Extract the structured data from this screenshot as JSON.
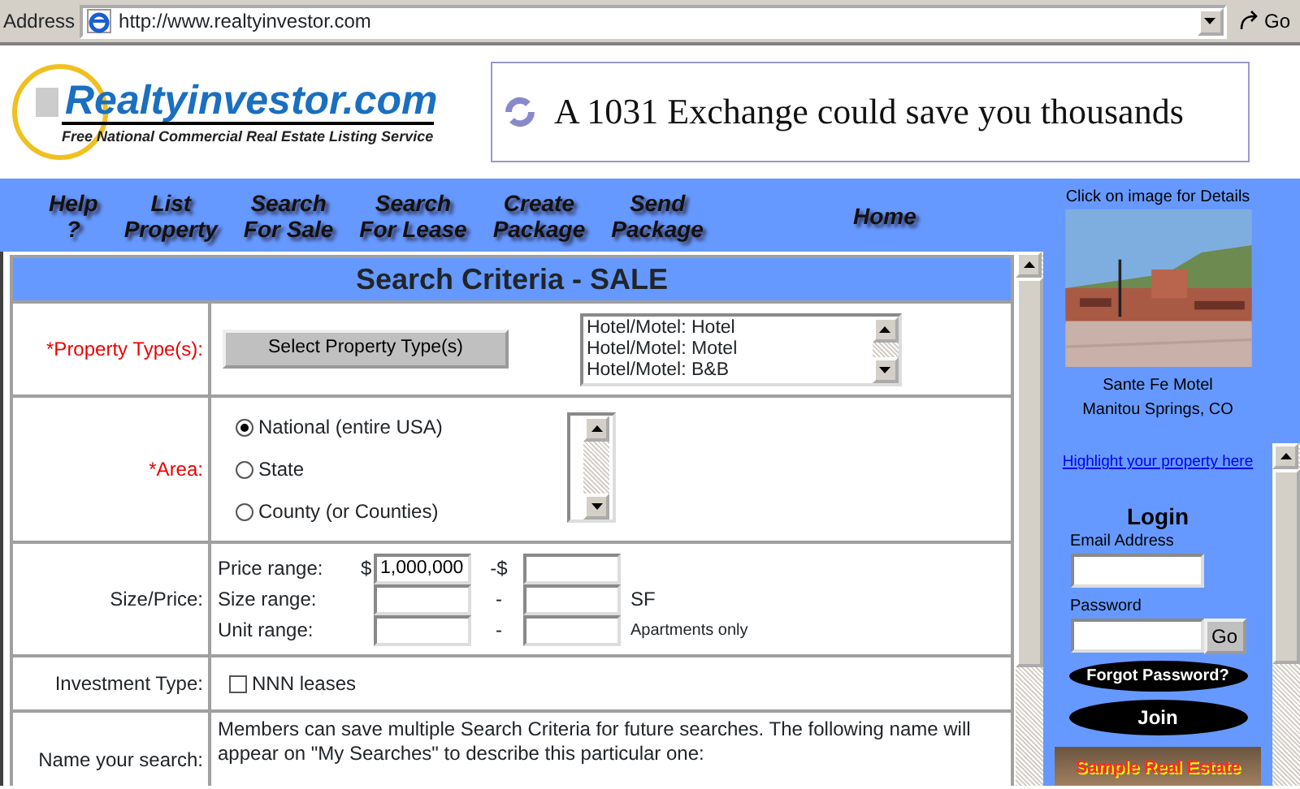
{
  "address_bar": {
    "label": "Address",
    "url": "http://www.realtyinvestor.com",
    "go": "Go"
  },
  "header": {
    "logo_title": "Realtyinvestor.com",
    "logo_tagline": "Free National Commercial Real Estate Listing Service",
    "banner_text": "A 1031 Exchange could save you thousands"
  },
  "nav": [
    {
      "lines": [
        "Help",
        "?"
      ]
    },
    {
      "lines": [
        "List",
        "Property"
      ]
    },
    {
      "lines": [
        "Search",
        "For Sale"
      ]
    },
    {
      "lines": [
        "Search",
        "For Lease"
      ]
    },
    {
      "lines": [
        "Create",
        "Package"
      ]
    },
    {
      "lines": [
        "Send",
        "Package"
      ]
    },
    {
      "lines": [
        "Home"
      ]
    }
  ],
  "form": {
    "title": "Search Criteria - SALE",
    "rows": [
      {
        "kind": "types",
        "label": "*Property Type(s):",
        "required": true,
        "button": "Select Property Type(s)",
        "list": [
          "Hotel/Motel: Hotel",
          "Hotel/Motel: Motel",
          "Hotel/Motel: B&B"
        ]
      },
      {
        "kind": "area",
        "label": "*Area:",
        "required": true,
        "radios": [
          {
            "label": "National (entire USA)",
            "selected": true
          },
          {
            "label": "State",
            "selected": false
          },
          {
            "label": "County (or Counties)",
            "selected": false
          }
        ]
      },
      {
        "kind": "ranges",
        "label": "Size/Price:",
        "required": false,
        "ranges": [
          {
            "label": "Price range:",
            "prefix": "$",
            "from": "1,000,000",
            "sep": "-$"
          },
          {
            "label": "Size range:",
            "sep": "-",
            "unit": "SF"
          },
          {
            "label": "Unit range:",
            "sep": "-",
            "unit": "Apartments only"
          }
        ]
      },
      {
        "kind": "check",
        "label": "Investment Type:",
        "required": false,
        "checkbox": {
          "label": "NNN leases",
          "checked": false
        }
      },
      {
        "kind": "name",
        "label": "Name your search:",
        "required": false,
        "text": "Members can save multiple Search Criteria for future searches.  The following name will appear on \"My Searches\" to describe this particular one:"
      }
    ]
  },
  "sidebar": {
    "caption": "Click on image for Details",
    "property_name": "Sante Fe Motel",
    "property_location": "Manitou Springs, CO",
    "link": "Highlight your property here",
    "login": {
      "title": "Login",
      "email_label": "Email Address",
      "password_label": "Password",
      "go": "Go",
      "forgot": "Forgot Password?",
      "join": "Join"
    },
    "sample_banner": "Sample Real Estate"
  }
}
